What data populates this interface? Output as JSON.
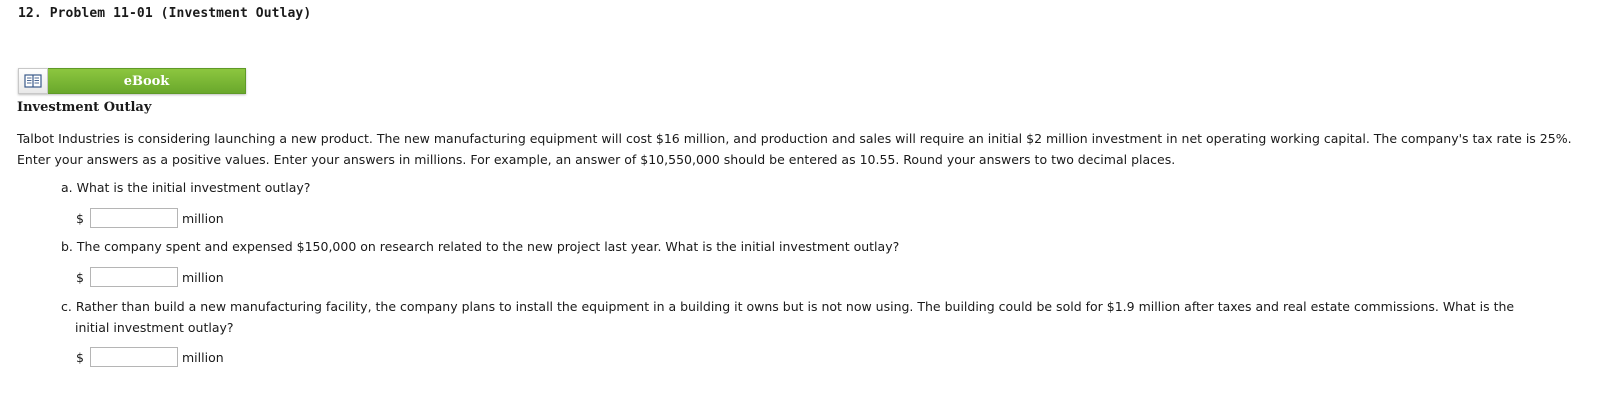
{
  "problem": {
    "title": "12.  Problem 11-01 (Investment Outlay)"
  },
  "ebook": {
    "label": "eBook",
    "icon": "book-icon"
  },
  "section": {
    "heading": "Investment Outlay"
  },
  "intro": {
    "text": "Talbot Industries is considering launching a new product. The new manufacturing equipment will cost $16 million, and production and sales will require an initial $2 million investment in net operating working capital. The company's tax rate is 25%. Enter your answers as a positive values. Enter your answers in millions. For example, an answer of $10,550,000 should be entered as 10.55. Round your answers to two decimal places."
  },
  "questions": [
    {
      "text": "a. What is the initial investment outlay?",
      "currency": "$",
      "value": "",
      "unit": "million"
    },
    {
      "text": "b. The company spent and expensed $150,000 on research related to the new project last year. What is the initial investment outlay?",
      "currency": "$",
      "value": "",
      "unit": "million"
    },
    {
      "text": "c. Rather than build a new manufacturing facility, the company plans to install the equipment in a building it owns but is not now using. The building could be sold for $1.9 million after taxes and real estate commissions. What is the initial investment outlay?",
      "currency": "$",
      "value": "",
      "unit": "million"
    }
  ],
  "colors": {
    "ebook_green": "#7ab935",
    "text": "#1a1a1a",
    "input_border": "#b5b5b5"
  }
}
